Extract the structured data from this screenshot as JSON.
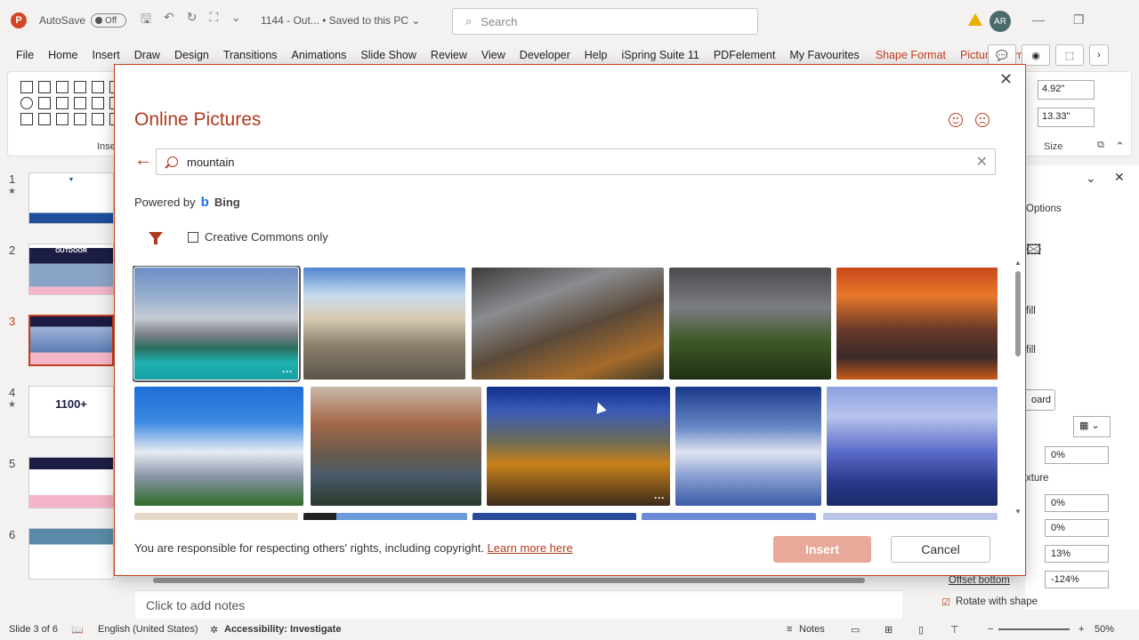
{
  "titlebar": {
    "autosave_label": "AutoSave",
    "autosave_state": "Off",
    "doc_title": "1144 - Out...  •  Saved to this PC ⌄",
    "search_placeholder": "Search",
    "avatar_initials": "AR"
  },
  "ribbon_tabs": [
    "File",
    "Home",
    "Insert",
    "Draw",
    "Design",
    "Transitions",
    "Animations",
    "Slide Show",
    "Review",
    "View",
    "Developer",
    "Help",
    "iSpring Suite 11",
    "PDFelement",
    "My Favourites",
    "Shape Format",
    "Picture Format"
  ],
  "ribbon": {
    "insert_group_label": "Inse",
    "size_group_label": "Size",
    "height_value": "4.92\"",
    "width_value": "13.33\""
  },
  "slides": [
    {
      "num": "1",
      "star": "★",
      "title": ""
    },
    {
      "num": "2",
      "star": "",
      "title": "OUTDOOR"
    },
    {
      "num": "3",
      "star": "",
      "title": ""
    },
    {
      "num": "4",
      "star": "★",
      "title": "1100+"
    },
    {
      "num": "5",
      "star": "",
      "title": ""
    },
    {
      "num": "6",
      "star": "",
      "title": ""
    }
  ],
  "right_pane": {
    "options_label": "Options",
    "fill1": "fill",
    "fill2": "fill",
    "board_btn": "oard",
    "texture_label": "xture",
    "spin1": "0%",
    "spin2": "0%",
    "spin3": "0%",
    "spin4": "13%",
    "spin5": "-124%",
    "offset_bottom_label": "Offset bottom",
    "rotate_label": "Rotate with shape"
  },
  "dialog": {
    "title": "Online Pictures",
    "search_value": "mountain",
    "powered_by": "Powered by",
    "bing": "Bing",
    "cc_label": "Creative Commons only",
    "footer_text": "You are responsible for respecting others' rights, including copyright.",
    "learn_more": "Learn more here",
    "insert_label": "Insert",
    "cancel_label": "Cancel"
  },
  "notes_placeholder": "Click to add notes",
  "statusbar": {
    "slide_info": "Slide 3 of 6",
    "language": "English (United States)",
    "accessibility": "Accessibility: Investigate",
    "notes_label": "Notes",
    "zoom": "50%"
  },
  "colors": {
    "accent": "#b03a1e",
    "context_tab": "#c43e1c",
    "insert_disabled": "#e8a89a"
  }
}
